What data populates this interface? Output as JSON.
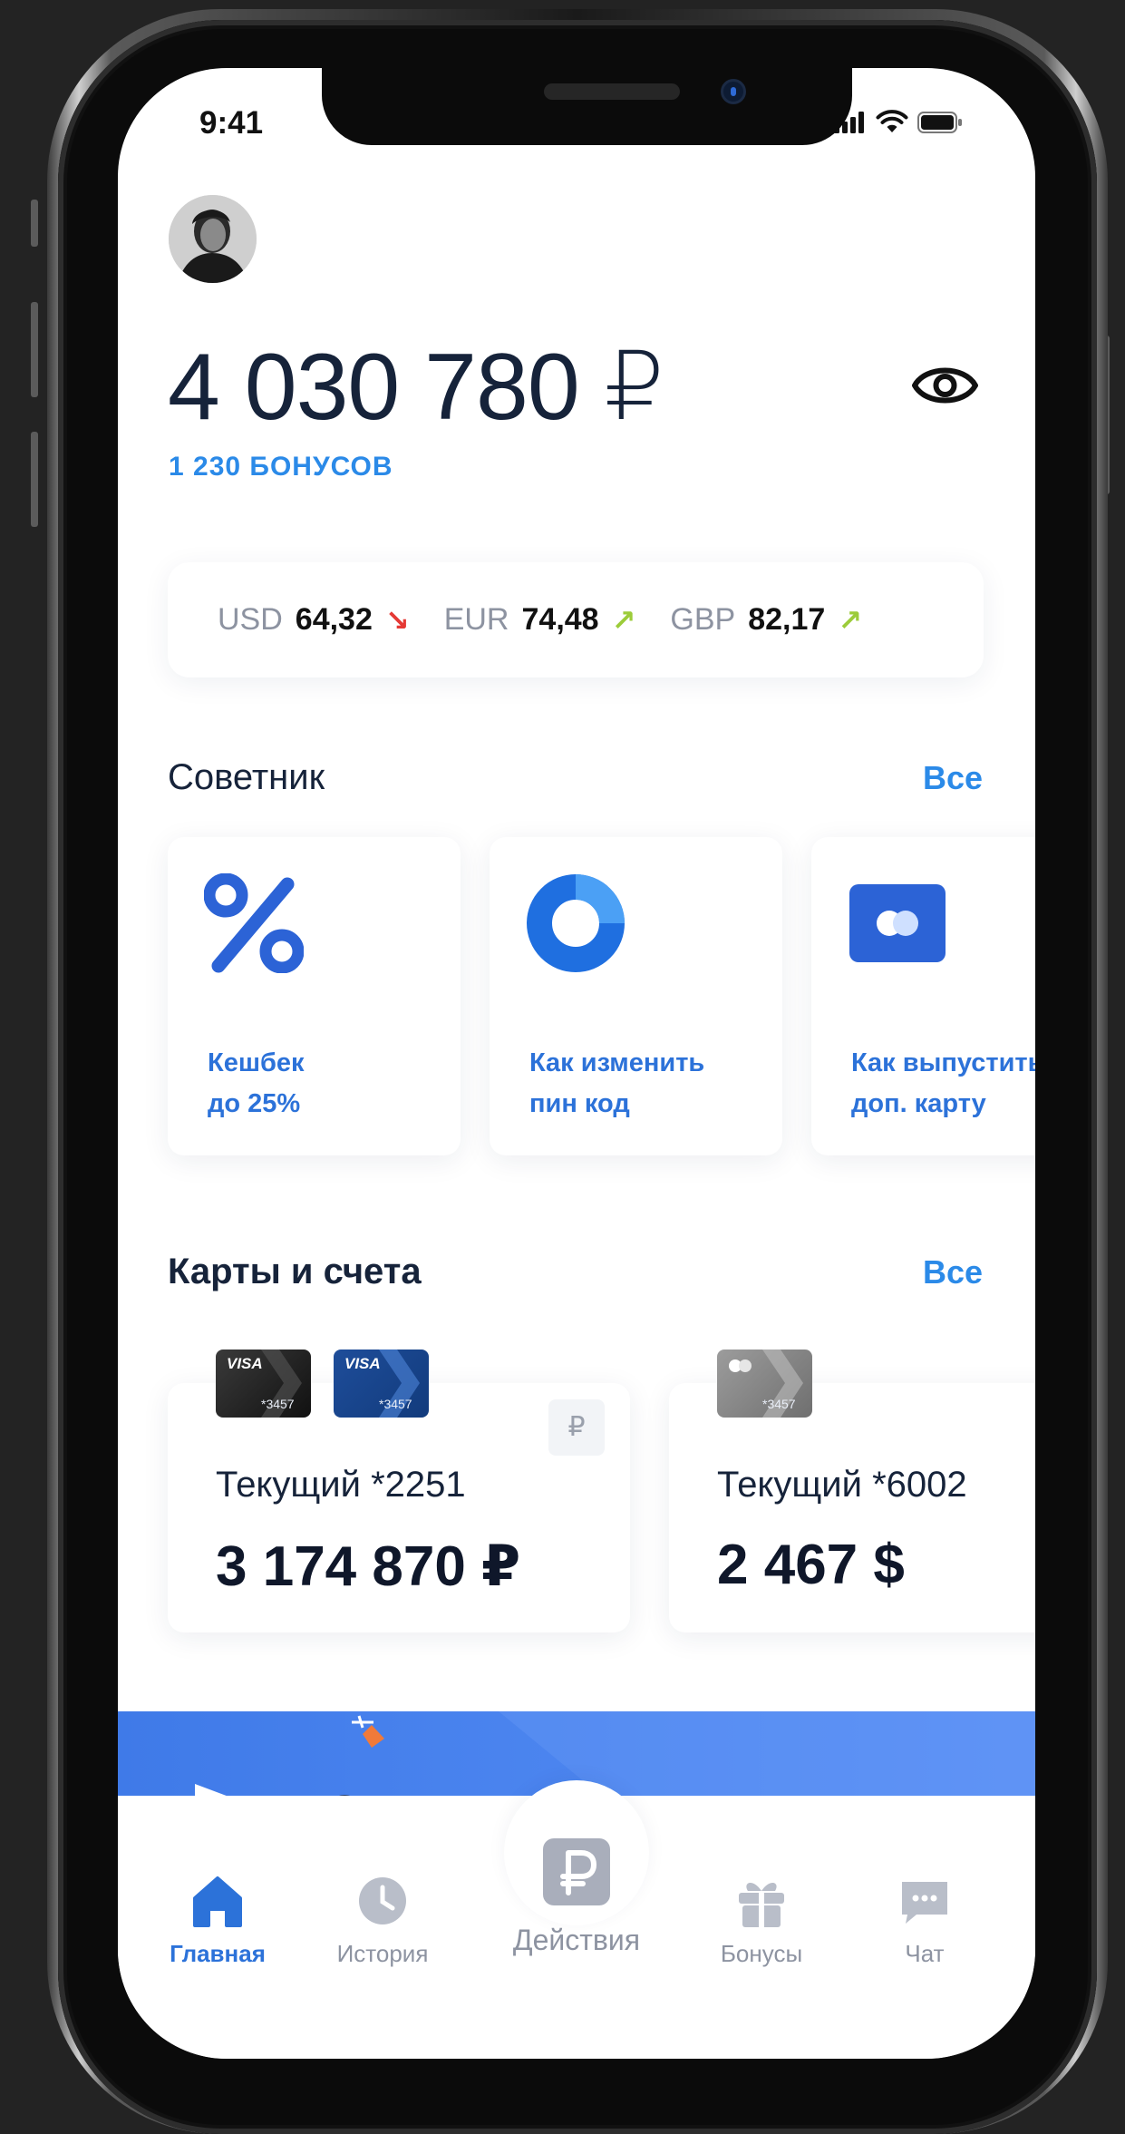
{
  "status_bar": {
    "time": "9:41"
  },
  "header": {
    "balance": "4 030 780 ₽",
    "bonus": "1 230 БОНУСОВ"
  },
  "rates": [
    {
      "code": "USD",
      "value": "64,32",
      "trend": "down",
      "color": "#e53935"
    },
    {
      "code": "EUR",
      "value": "74,48",
      "trend": "up",
      "color": "#9ccc3a"
    },
    {
      "code": "GBP",
      "value": "82,17",
      "trend": "up",
      "color": "#9ccc3a"
    }
  ],
  "advisor": {
    "title": "Советник",
    "all_link": "Все",
    "cards": [
      {
        "line1": "Кешбек",
        "line2": "до 25%",
        "icon": "percent-icon"
      },
      {
        "line1": "Как изменить",
        "line2": "пин код",
        "icon": "donut-icon"
      },
      {
        "line1": "Как выпустить",
        "line2": "доп. карту",
        "icon": "card-icon"
      }
    ]
  },
  "accounts": {
    "title": "Карты и счета",
    "all_link": "Все",
    "items": [
      {
        "name": "Текущий *2251",
        "amount": "3 174 870 ₽",
        "currency_symbol": "₽",
        "cards": [
          {
            "brand": "VISA",
            "number": "*3457"
          },
          {
            "brand": "VISA",
            "number": "*3457"
          }
        ]
      },
      {
        "name": "Текущий *6002",
        "amount": "2 467 $",
        "cards": [
          {
            "brand": "",
            "number": "*3457"
          }
        ]
      }
    ]
  },
  "tabbar": {
    "items": [
      {
        "label": "Главная",
        "icon": "home-icon",
        "active": true
      },
      {
        "label": "История",
        "icon": "clock-icon",
        "active": false
      },
      {
        "label": "Действия",
        "icon": "ruble-icon",
        "active": false
      },
      {
        "label": "Бонусы",
        "icon": "gift-icon",
        "active": false
      },
      {
        "label": "Чат",
        "icon": "chat-icon",
        "active": false
      }
    ]
  },
  "colors": {
    "accent": "#2b8ae8",
    "primary_blue": "#2c72d9",
    "text_dark": "#16233a",
    "muted": "#8d93a1"
  }
}
